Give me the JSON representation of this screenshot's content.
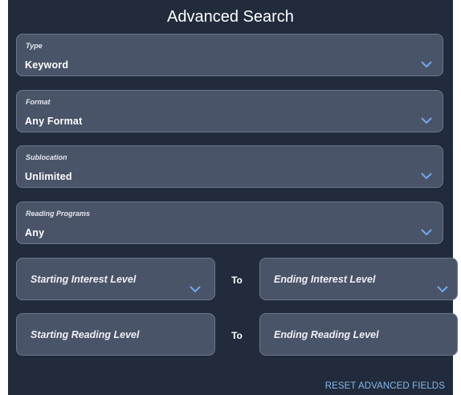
{
  "panel": {
    "title": "Advanced Search"
  },
  "fields": {
    "type": {
      "label": "Type",
      "value": "Keyword"
    },
    "format": {
      "label": "Format",
      "value": "Any Format"
    },
    "sublocation": {
      "label": "Sublocation",
      "value": "Unlimited"
    },
    "reading_programs": {
      "label": "Reading Programs",
      "value": "Any"
    }
  },
  "interest_level": {
    "start_placeholder": "Starting Interest Level",
    "separator": "To",
    "end_placeholder": "Ending Interest Level"
  },
  "reading_level": {
    "start_placeholder": "Starting Reading Level",
    "separator": "To",
    "end_placeholder": "Ending Reading Level"
  },
  "actions": {
    "reset_label": "RESET ADVANCED FIELDS"
  },
  "colors": {
    "panel_bg": "#212b3b",
    "field_bg": "#4a5468",
    "field_border": "#6c7589",
    "chevron": "#6fa8ee",
    "link": "#86b7f0"
  },
  "icons": {
    "dropdown": "chevron-down-icon"
  }
}
